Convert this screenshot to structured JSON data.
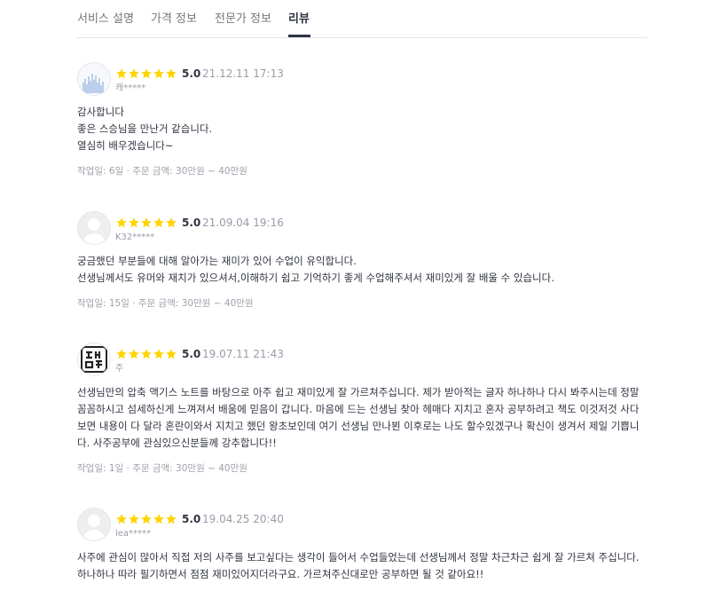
{
  "tabs": [
    "서비스 설명",
    "가격 정보",
    "전문가 정보",
    "리뷰"
  ],
  "colors": {
    "star": "#ffd400",
    "text": "#303441",
    "muted": "#9a9ba7"
  },
  "reviews": [
    {
      "rating": "5.0",
      "date": "21.12.11 17:13",
      "user": "캐*****",
      "avatar": "graph-image",
      "stars": 5,
      "content": [
        "감사합니다",
        "좋은 스승님을 만난거 같습니다.",
        "열심히 배우겠습니다~"
      ],
      "meta": "작업일: 6일 · 주문 금액: 30만원 ~ 40만원"
    },
    {
      "rating": "5.0",
      "date": "21.09.04 19:16",
      "user": "K32*****",
      "avatar": "default-user-icon",
      "stars": 5,
      "content": [
        "궁금했던 부분들에 대해 알아가는 재미가 있어 수업이 유익합니다.",
        "선생님께서도 유머와 재치가 있으셔서,이해하기 쉽고 기억하기 좋게 수업해주셔서 재미있게 잘 배울 수 있습니다."
      ],
      "meta": "작업일: 15일 · 주문 금액: 30만원 ~ 40만원"
    },
    {
      "rating": "5.0",
      "date": "19.07.11 21:43",
      "user": "주",
      "avatar": "seal-stamp",
      "stars": 5,
      "content": [
        "선생님만의 압축 액기스 노트를 바탕으로 아주 쉽고 재미있게 잘 가르쳐주십니다. 제가 받아적는 글자 하나하나 다시 봐주시는데 정말",
        "꼼꼼하시고 섬세하신게 느껴져서 배움에 믿음이 갑니다. 마음에 드는 선생님 찾아 헤매다 지치고 혼자 공부하려고 책도 이것저것 사다",
        "보면 내용이 다 달라 혼란이와서 지치고 했던 왕초보인데 여기 선생님 만나뵌 이후로는 나도 할수있겠구나 확신이 생겨서 제일 기쁩니",
        "다. 사주공부에 관심있으신분들께 강추합니다!!"
      ],
      "meta": "작업일: 1일 · 주문 금액: 30만원 ~ 40만원"
    },
    {
      "rating": "5.0",
      "date": "19.04.25 20:40",
      "user": "lea*****",
      "avatar": "default-user-icon",
      "stars": 5,
      "content": [
        "사주에 관심이 많아서 직접 저의 사주를 보고싶다는 생각이 들어서 수업들었는데 선생님께서 정말 차근차근 쉽게 잘 가르쳐 주십니다.",
        "하나하나 따라 필기하면서 점점 재미있어지더라구요. 가르쳐주신대로만 공부하면 될 것 같아요!!"
      ],
      "meta": ""
    }
  ]
}
